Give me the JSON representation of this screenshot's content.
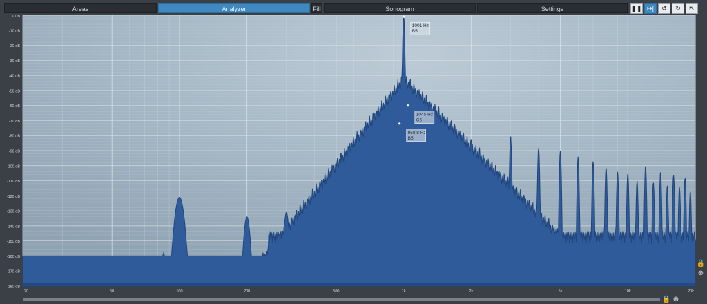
{
  "tabs": {
    "areas": "Areas",
    "analyzer": "Analyzer",
    "fill": "Fill",
    "sonogram": "Sonogram",
    "settings": "Settings"
  },
  "colors": {
    "plot_bg_center": "#b6c5d0",
    "plot_bg_edge": "#8ea2b2",
    "fill": "#2f5b9a",
    "stroke": "#21467d",
    "accent": "#3f88c0"
  },
  "icons": {
    "pause": "pause-icon",
    "freeze": "freeze-icon",
    "undo": "undo-icon",
    "redo": "redo-icon",
    "export": "export-icon",
    "lock": "lock-icon",
    "zoom": "zoom-icon"
  },
  "chart_data": {
    "type": "area",
    "xscale": "log",
    "xlim": [
      20,
      20000
    ],
    "ylim": [
      -180,
      0
    ],
    "grid": true,
    "y_ticks": [
      "0 dB",
      "-10 dB",
      "-20 dB",
      "-30 dB",
      "-40 dB",
      "-50 dB",
      "-60 dB",
      "-70 dB",
      "-80 dB",
      "-90 dB",
      "-100 dB",
      "-110 dB",
      "-120 dB",
      "-130 dB",
      "-140 dB",
      "-150 dB",
      "-160 dB",
      "-170 dB",
      "-180 dB"
    ],
    "x_ticks": [
      {
        "value": 20,
        "label": "20"
      },
      {
        "value": 50,
        "label": "50"
      },
      {
        "value": 100,
        "label": "100"
      },
      {
        "value": 200,
        "label": "200"
      },
      {
        "value": 500,
        "label": "500"
      },
      {
        "value": 1000,
        "label": "1k"
      },
      {
        "value": 2000,
        "label": "2k"
      },
      {
        "value": 5000,
        "label": "5k"
      },
      {
        "value": 10000,
        "label": "10k"
      },
      {
        "value": 20000,
        "label": "20k"
      }
    ],
    "floor_db": -160,
    "peaks": [
      {
        "f": 85,
        "db": -158,
        "w": 0.012
      },
      {
        "f": 100,
        "db": -121,
        "w": 0.03
      },
      {
        "f": 200,
        "db": -134,
        "w": 0.02
      },
      {
        "f": 300,
        "db": -131,
        "w": 0.016
      },
      {
        "f": 1001,
        "db": -0.5,
        "w": 0.006
      },
      {
        "f": 1045,
        "db": -60,
        "w": 0.005
      },
      {
        "f": 958.8,
        "db": -72,
        "w": 0.005
      },
      {
        "f": 2000,
        "db": -82,
        "w": 0.006
      },
      {
        "f": 3000,
        "db": -80,
        "w": 0.006
      },
      {
        "f": 4000,
        "db": -88,
        "w": 0.006
      },
      {
        "f": 5000,
        "db": -90,
        "w": 0.006
      },
      {
        "f": 6000,
        "db": -94,
        "w": 0.006
      },
      {
        "f": 7000,
        "db": -97,
        "w": 0.006
      },
      {
        "f": 8000,
        "db": -101,
        "w": 0.006
      },
      {
        "f": 9000,
        "db": -104,
        "w": 0.006
      },
      {
        "f": 10000,
        "db": -105,
        "w": 0.006
      },
      {
        "f": 11000,
        "db": -110,
        "w": 0.006
      },
      {
        "f": 12000,
        "db": -100,
        "w": 0.006
      },
      {
        "f": 13000,
        "db": -111,
        "w": 0.006
      },
      {
        "f": 14000,
        "db": -104,
        "w": 0.006
      },
      {
        "f": 15000,
        "db": -113,
        "w": 0.006
      },
      {
        "f": 16000,
        "db": -106,
        "w": 0.006
      },
      {
        "f": 17000,
        "db": -114,
        "w": 0.006
      },
      {
        "f": 18000,
        "db": -108,
        "w": 0.006
      },
      {
        "f": 19000,
        "db": -117,
        "w": 0.006
      }
    ],
    "annotations": [
      {
        "f": 1001,
        "db": -1,
        "line1": "1001 Hz",
        "line2": "B5"
      },
      {
        "f": 1045,
        "db": -60,
        "line1": "1045 Hz",
        "line2": "C6"
      },
      {
        "f": 958.8,
        "db": -72,
        "line1": "958.8 Hz",
        "line2": "B5"
      }
    ]
  }
}
